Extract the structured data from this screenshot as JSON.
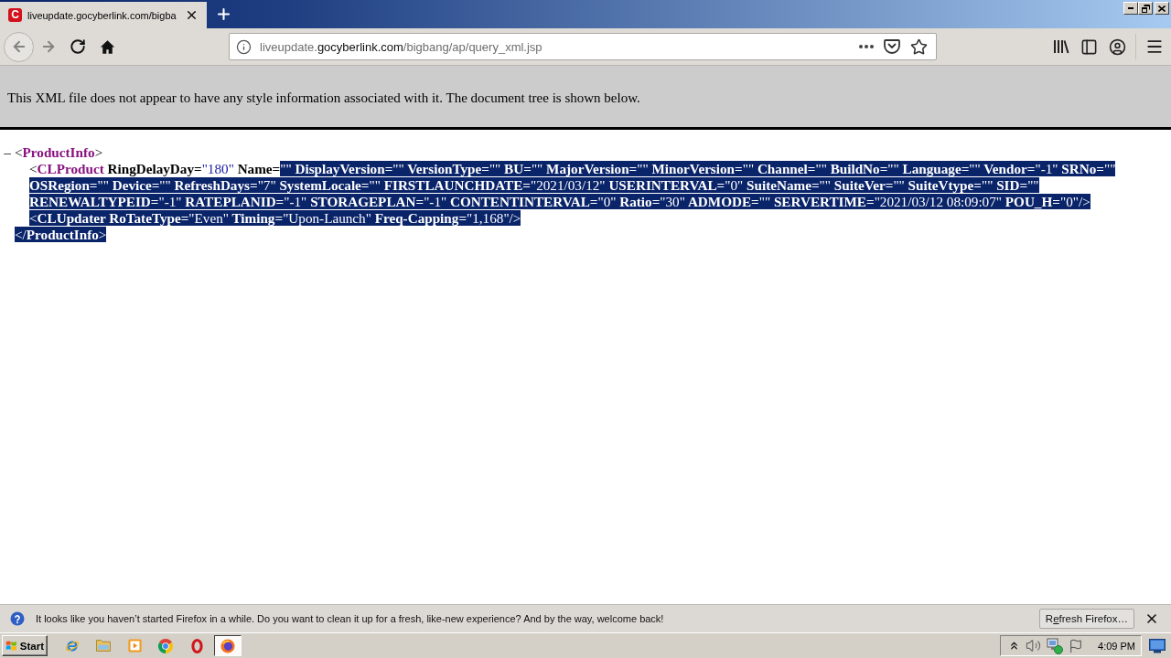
{
  "browser": {
    "tabs": [
      {
        "icon_text": "C",
        "title": "liveupdate.gocyberlink.com/bigba",
        "selected": true
      }
    ],
    "nav_buttons": [
      {
        "kind": "back",
        "disabled": true
      },
      {
        "kind": "forward",
        "disabled": true
      },
      {
        "kind": "reload",
        "disabled": false
      },
      {
        "kind": "home",
        "disabled": false
      }
    ],
    "address": {
      "subdomain": "liveupdate.",
      "domain": "gocyberlink.com",
      "path": "/bigbang/ap/query_xml.jsp"
    }
  },
  "page": {
    "notice": "This XML file does not appear to have any style information associated with it. The document tree is shown below.",
    "tree": [
      {
        "toggle": "–",
        "lines": [
          {
            "segments": [
              {
                "selected": false,
                "tokens": [
                  {
                    "kind": "markup",
                    "text": "<"
                  },
                  {
                    "kind": "tag",
                    "text": "ProductInfo"
                  },
                  {
                    "kind": "markup",
                    "text": ">"
                  }
                ]
              }
            ]
          }
        ],
        "children": [
          {
            "lines": [
              {
                "segments": [
                  {
                    "selected": false,
                    "tokens": [
                      {
                        "kind": "markup",
                        "text": "<"
                      },
                      {
                        "kind": "tag",
                        "text": "CLProduct"
                      },
                      {
                        "kind": "attr",
                        "text": " RingDelayDay="
                      },
                      {
                        "kind": "value",
                        "text": "\"180\""
                      },
                      {
                        "kind": "attr",
                        "text": " Name="
                      }
                    ]
                  },
                  {
                    "selected": true,
                    "tokens": [
                      {
                        "kind": "value",
                        "text": "\"\""
                      },
                      {
                        "kind": "attr",
                        "text": " DisplayVersion="
                      },
                      {
                        "kind": "value",
                        "text": "\"\""
                      },
                      {
                        "kind": "attr",
                        "text": " VersionType="
                      },
                      {
                        "kind": "value",
                        "text": "\"\""
                      },
                      {
                        "kind": "attr",
                        "text": " BU="
                      },
                      {
                        "kind": "value",
                        "text": "\"\""
                      },
                      {
                        "kind": "attr",
                        "text": " MajorVersion="
                      },
                      {
                        "kind": "value",
                        "text": "\"\""
                      },
                      {
                        "kind": "attr",
                        "text": " MinorVersion="
                      },
                      {
                        "kind": "value",
                        "text": "\"\""
                      },
                      {
                        "kind": "attr",
                        "text": " Channel="
                      },
                      {
                        "kind": "value",
                        "text": "\"\""
                      },
                      {
                        "kind": "attr",
                        "text": " BuildNo="
                      },
                      {
                        "kind": "value",
                        "text": "\"\""
                      },
                      {
                        "kind": "attr",
                        "text": " Language="
                      },
                      {
                        "kind": "value",
                        "text": "\"\""
                      },
                      {
                        "kind": "attr",
                        "text": " Vendor="
                      },
                      {
                        "kind": "value",
                        "text": "\"-1\""
                      },
                      {
                        "kind": "attr",
                        "text": " SRNo="
                      },
                      {
                        "kind": "value",
                        "text": "\"\""
                      }
                    ]
                  }
                ]
              },
              {
                "segments": [
                  {
                    "selected": true,
                    "tokens": [
                      {
                        "kind": "attr",
                        "text": "OSRegion="
                      },
                      {
                        "kind": "value",
                        "text": "\"\""
                      },
                      {
                        "kind": "attr",
                        "text": " Device="
                      },
                      {
                        "kind": "value",
                        "text": "\"\""
                      },
                      {
                        "kind": "attr",
                        "text": " RefreshDays="
                      },
                      {
                        "kind": "value",
                        "text": "\"7\""
                      },
                      {
                        "kind": "attr",
                        "text": " SystemLocale="
                      },
                      {
                        "kind": "value",
                        "text": "\"\""
                      },
                      {
                        "kind": "attr",
                        "text": " FIRSTLAUNCHDATE="
                      },
                      {
                        "kind": "value",
                        "text": "\"2021/03/12\""
                      },
                      {
                        "kind": "attr",
                        "text": " USERINTERVAL="
                      },
                      {
                        "kind": "value",
                        "text": "\"0\""
                      },
                      {
                        "kind": "attr",
                        "text": " SuiteName="
                      },
                      {
                        "kind": "value",
                        "text": "\"\""
                      },
                      {
                        "kind": "attr",
                        "text": " SuiteVer="
                      },
                      {
                        "kind": "value",
                        "text": "\"\""
                      },
                      {
                        "kind": "attr",
                        "text": " SuiteVtype="
                      },
                      {
                        "kind": "value",
                        "text": "\"\""
                      },
                      {
                        "kind": "attr",
                        "text": " SID="
                      },
                      {
                        "kind": "value",
                        "text": "\"\""
                      }
                    ]
                  }
                ]
              },
              {
                "segments": [
                  {
                    "selected": true,
                    "tokens": [
                      {
                        "kind": "attr",
                        "text": "RENEWALTYPEID="
                      },
                      {
                        "kind": "value",
                        "text": "\"-1\""
                      },
                      {
                        "kind": "attr",
                        "text": " RATEPLANID="
                      },
                      {
                        "kind": "value",
                        "text": "\"-1\""
                      },
                      {
                        "kind": "attr",
                        "text": " STORAGEPLAN="
                      },
                      {
                        "kind": "value",
                        "text": "\"-1\""
                      },
                      {
                        "kind": "attr",
                        "text": " CONTENTINTERVAL="
                      },
                      {
                        "kind": "value",
                        "text": "\"0\""
                      },
                      {
                        "kind": "attr",
                        "text": " Ratio="
                      },
                      {
                        "kind": "value",
                        "text": "\"30\""
                      },
                      {
                        "kind": "attr",
                        "text": " ADMODE="
                      },
                      {
                        "kind": "value",
                        "text": "\"\""
                      },
                      {
                        "kind": "attr",
                        "text": " SERVERTIME="
                      },
                      {
                        "kind": "value",
                        "text": "\"2021/03/12 08:09:07\""
                      },
                      {
                        "kind": "attr",
                        "text": " POU_H="
                      },
                      {
                        "kind": "value",
                        "text": "\"0\""
                      },
                      {
                        "kind": "markup",
                        "text": "/>"
                      }
                    ]
                  }
                ]
              }
            ]
          },
          {
            "lines": [
              {
                "segments": [
                  {
                    "selected": true,
                    "tokens": [
                      {
                        "kind": "markup",
                        "text": "<"
                      },
                      {
                        "kind": "tag",
                        "text": "CLUpdater"
                      },
                      {
                        "kind": "attr",
                        "text": " RoTateType="
                      },
                      {
                        "kind": "value",
                        "text": "\"Even\""
                      },
                      {
                        "kind": "attr",
                        "text": " Timing="
                      },
                      {
                        "kind": "value",
                        "text": "\"Upon-Launch\""
                      },
                      {
                        "kind": "attr",
                        "text": " Freq-Capping="
                      },
                      {
                        "kind": "value",
                        "text": "\"1,168\""
                      },
                      {
                        "kind": "markup",
                        "text": "/>"
                      }
                    ]
                  }
                ]
              }
            ]
          }
        ],
        "close_lines": [
          {
            "segments": [
              {
                "selected": true,
                "tokens": [
                  {
                    "kind": "markup",
                    "text": "</"
                  },
                  {
                    "kind": "tag",
                    "text": "ProductInfo"
                  },
                  {
                    "kind": "markup",
                    "text": ">"
                  }
                ]
              }
            ]
          }
        ]
      }
    ]
  },
  "notification": {
    "message": "It looks like you haven’t started Firefox in a while. Do you want to clean it up for a fresh, like-new experience? And by the way, welcome back!",
    "button_parts": [
      {
        "text": "R",
        "underlined": false
      },
      {
        "text": "e",
        "underlined": true
      },
      {
        "text": "fresh Firefox…",
        "underlined": false
      }
    ]
  },
  "taskbar": {
    "start": "Start",
    "apps": [
      {
        "kind": "swoosh_ring",
        "selected": false
      },
      {
        "kind": "folder",
        "selected": false
      },
      {
        "kind": "play_tile",
        "selected": false
      },
      {
        "kind": "segmented_circle",
        "selected": false
      },
      {
        "kind": "ring",
        "selected": false
      },
      {
        "kind": "orb",
        "selected": true
      }
    ],
    "clock": "4:09 PM"
  }
}
